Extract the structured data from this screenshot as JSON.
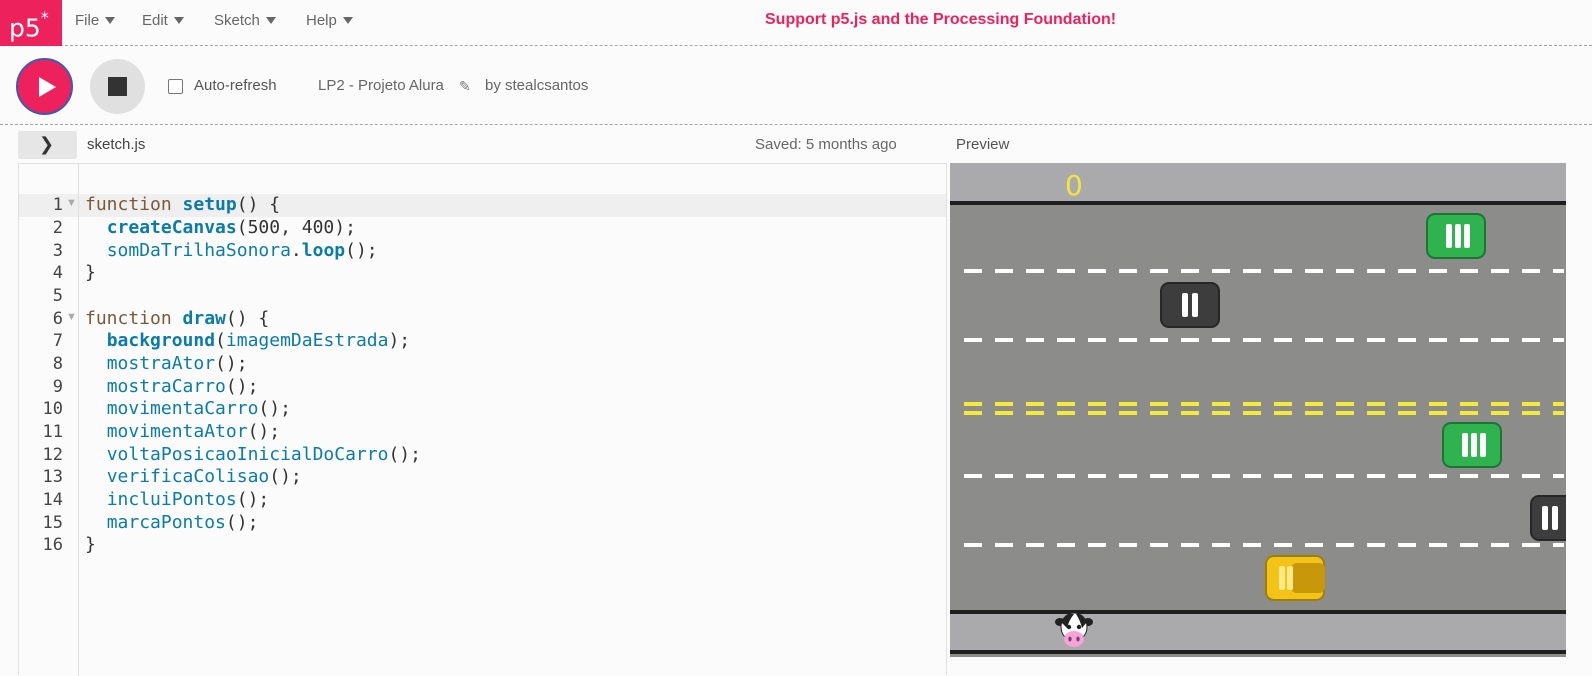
{
  "nav": {
    "logo_text": "p5",
    "logo_sup": "*",
    "menus": [
      {
        "label": "File"
      },
      {
        "label": "Edit"
      },
      {
        "label": "Sketch"
      },
      {
        "label": "Help"
      }
    ],
    "support_text": "Support p5.js and the Processing Foundation!",
    "accent_color": "#ed225d"
  },
  "toolbar": {
    "autorefresh_label": "Auto-refresh",
    "autorefresh_checked": false,
    "project_name": "LP2 - Projeto Alura",
    "owner": "by stealcsantos"
  },
  "editor": {
    "filename": "sketch.js",
    "saved_status": "Saved: 5 months ago",
    "lines": [
      "1",
      "2",
      "3",
      "4",
      "5",
      "6",
      "7",
      "8",
      "9",
      "10",
      "11",
      "12",
      "13",
      "14",
      "15",
      "16"
    ]
  },
  "preview": {
    "label": "Preview",
    "score": "0"
  }
}
